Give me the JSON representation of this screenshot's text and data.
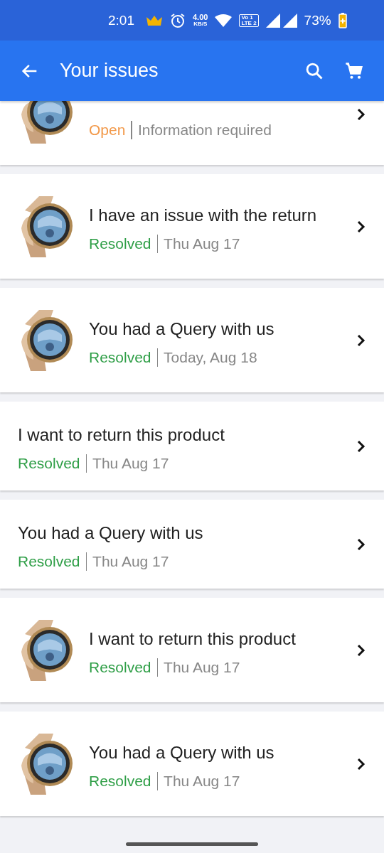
{
  "status_bar": {
    "time": "2:01",
    "speed_value": "4.00",
    "speed_unit": "KB/S",
    "network_badge_top": "Vo 1",
    "network_badge_bottom": "LTE 2",
    "battery": "73%"
  },
  "header": {
    "title": "Your issues"
  },
  "issues": [
    {
      "status": "Open",
      "color": "#f2994a",
      "detail": "Information required",
      "has_image": true
    },
    {
      "title": "I have an issue with the return",
      "status": "Resolved",
      "color": "#2e9e46",
      "detail": "Thu Aug 17",
      "has_image": true
    },
    {
      "title": "You had a Query with us",
      "status": "Resolved",
      "color": "#2e9e46",
      "detail": "Today, Aug 18",
      "has_image": true
    },
    {
      "title": "I want to return this product",
      "status": "Resolved",
      "color": "#2e9e46",
      "detail": "Thu Aug 17",
      "has_image": false
    },
    {
      "title": "You had a Query with us",
      "status": "Resolved",
      "color": "#2e9e46",
      "detail": "Thu Aug 17",
      "has_image": false
    },
    {
      "title": "I want to return this product",
      "status": "Resolved",
      "color": "#2e9e46",
      "detail": "Thu Aug 17",
      "has_image": true
    },
    {
      "title": "You had a Query with us",
      "status": "Resolved",
      "color": "#2e9e46",
      "detail": "Thu Aug 17",
      "has_image": true
    }
  ]
}
